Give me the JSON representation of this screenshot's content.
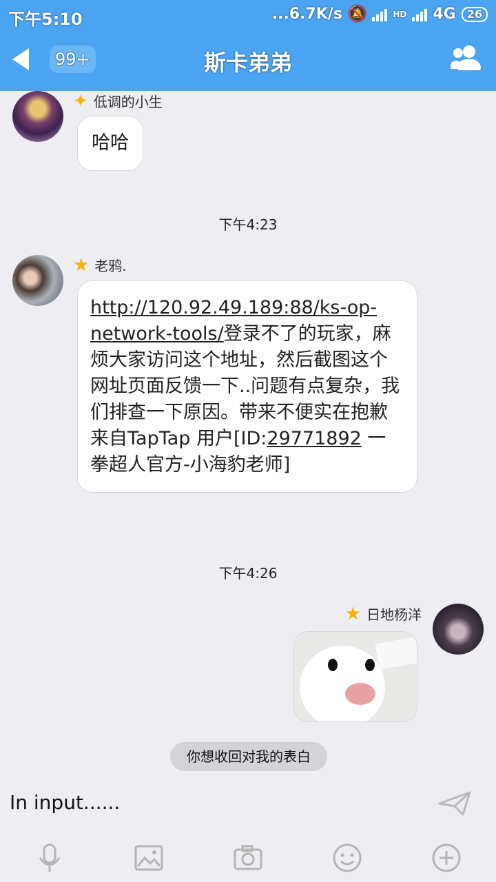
{
  "status_bar": {
    "time": "下午5:10",
    "network": "...6.7K/s",
    "mute": "🔕",
    "hd": "HD",
    "signal_type": "4G",
    "battery": "26"
  },
  "header": {
    "unread": "99+",
    "title": "斯卡弟弟"
  },
  "messages": [
    {
      "sender": "低调的小生",
      "text": "哈哈"
    },
    {
      "time": "下午4:23"
    },
    {
      "sender": "老鸦.",
      "link": "http://120.92.49.189:88/ks-op-network-tools/",
      "text": "登录不了的玩家，麻烦大家访问这个地址，然后截图这个网址页面反馈一下..问题有点复杂，我们排查一下原因。带来不便实在抱歉",
      "footer_prefix": "来自TapTap 用户[ID:",
      "footer_id": "29771892",
      "footer_suffix": " 一拳超人官方-小海豹老师]"
    },
    {
      "time": "下午4:26"
    },
    {
      "sender": "日地杨洋",
      "image": "white-bird-sticker"
    }
  ],
  "toast": "你想收回对我的表白",
  "input_placeholder": "In input......",
  "toolbar": {
    "icons": [
      "microphone-icon",
      "image-icon",
      "camera-icon",
      "emoji-icon",
      "plus-icon"
    ]
  }
}
